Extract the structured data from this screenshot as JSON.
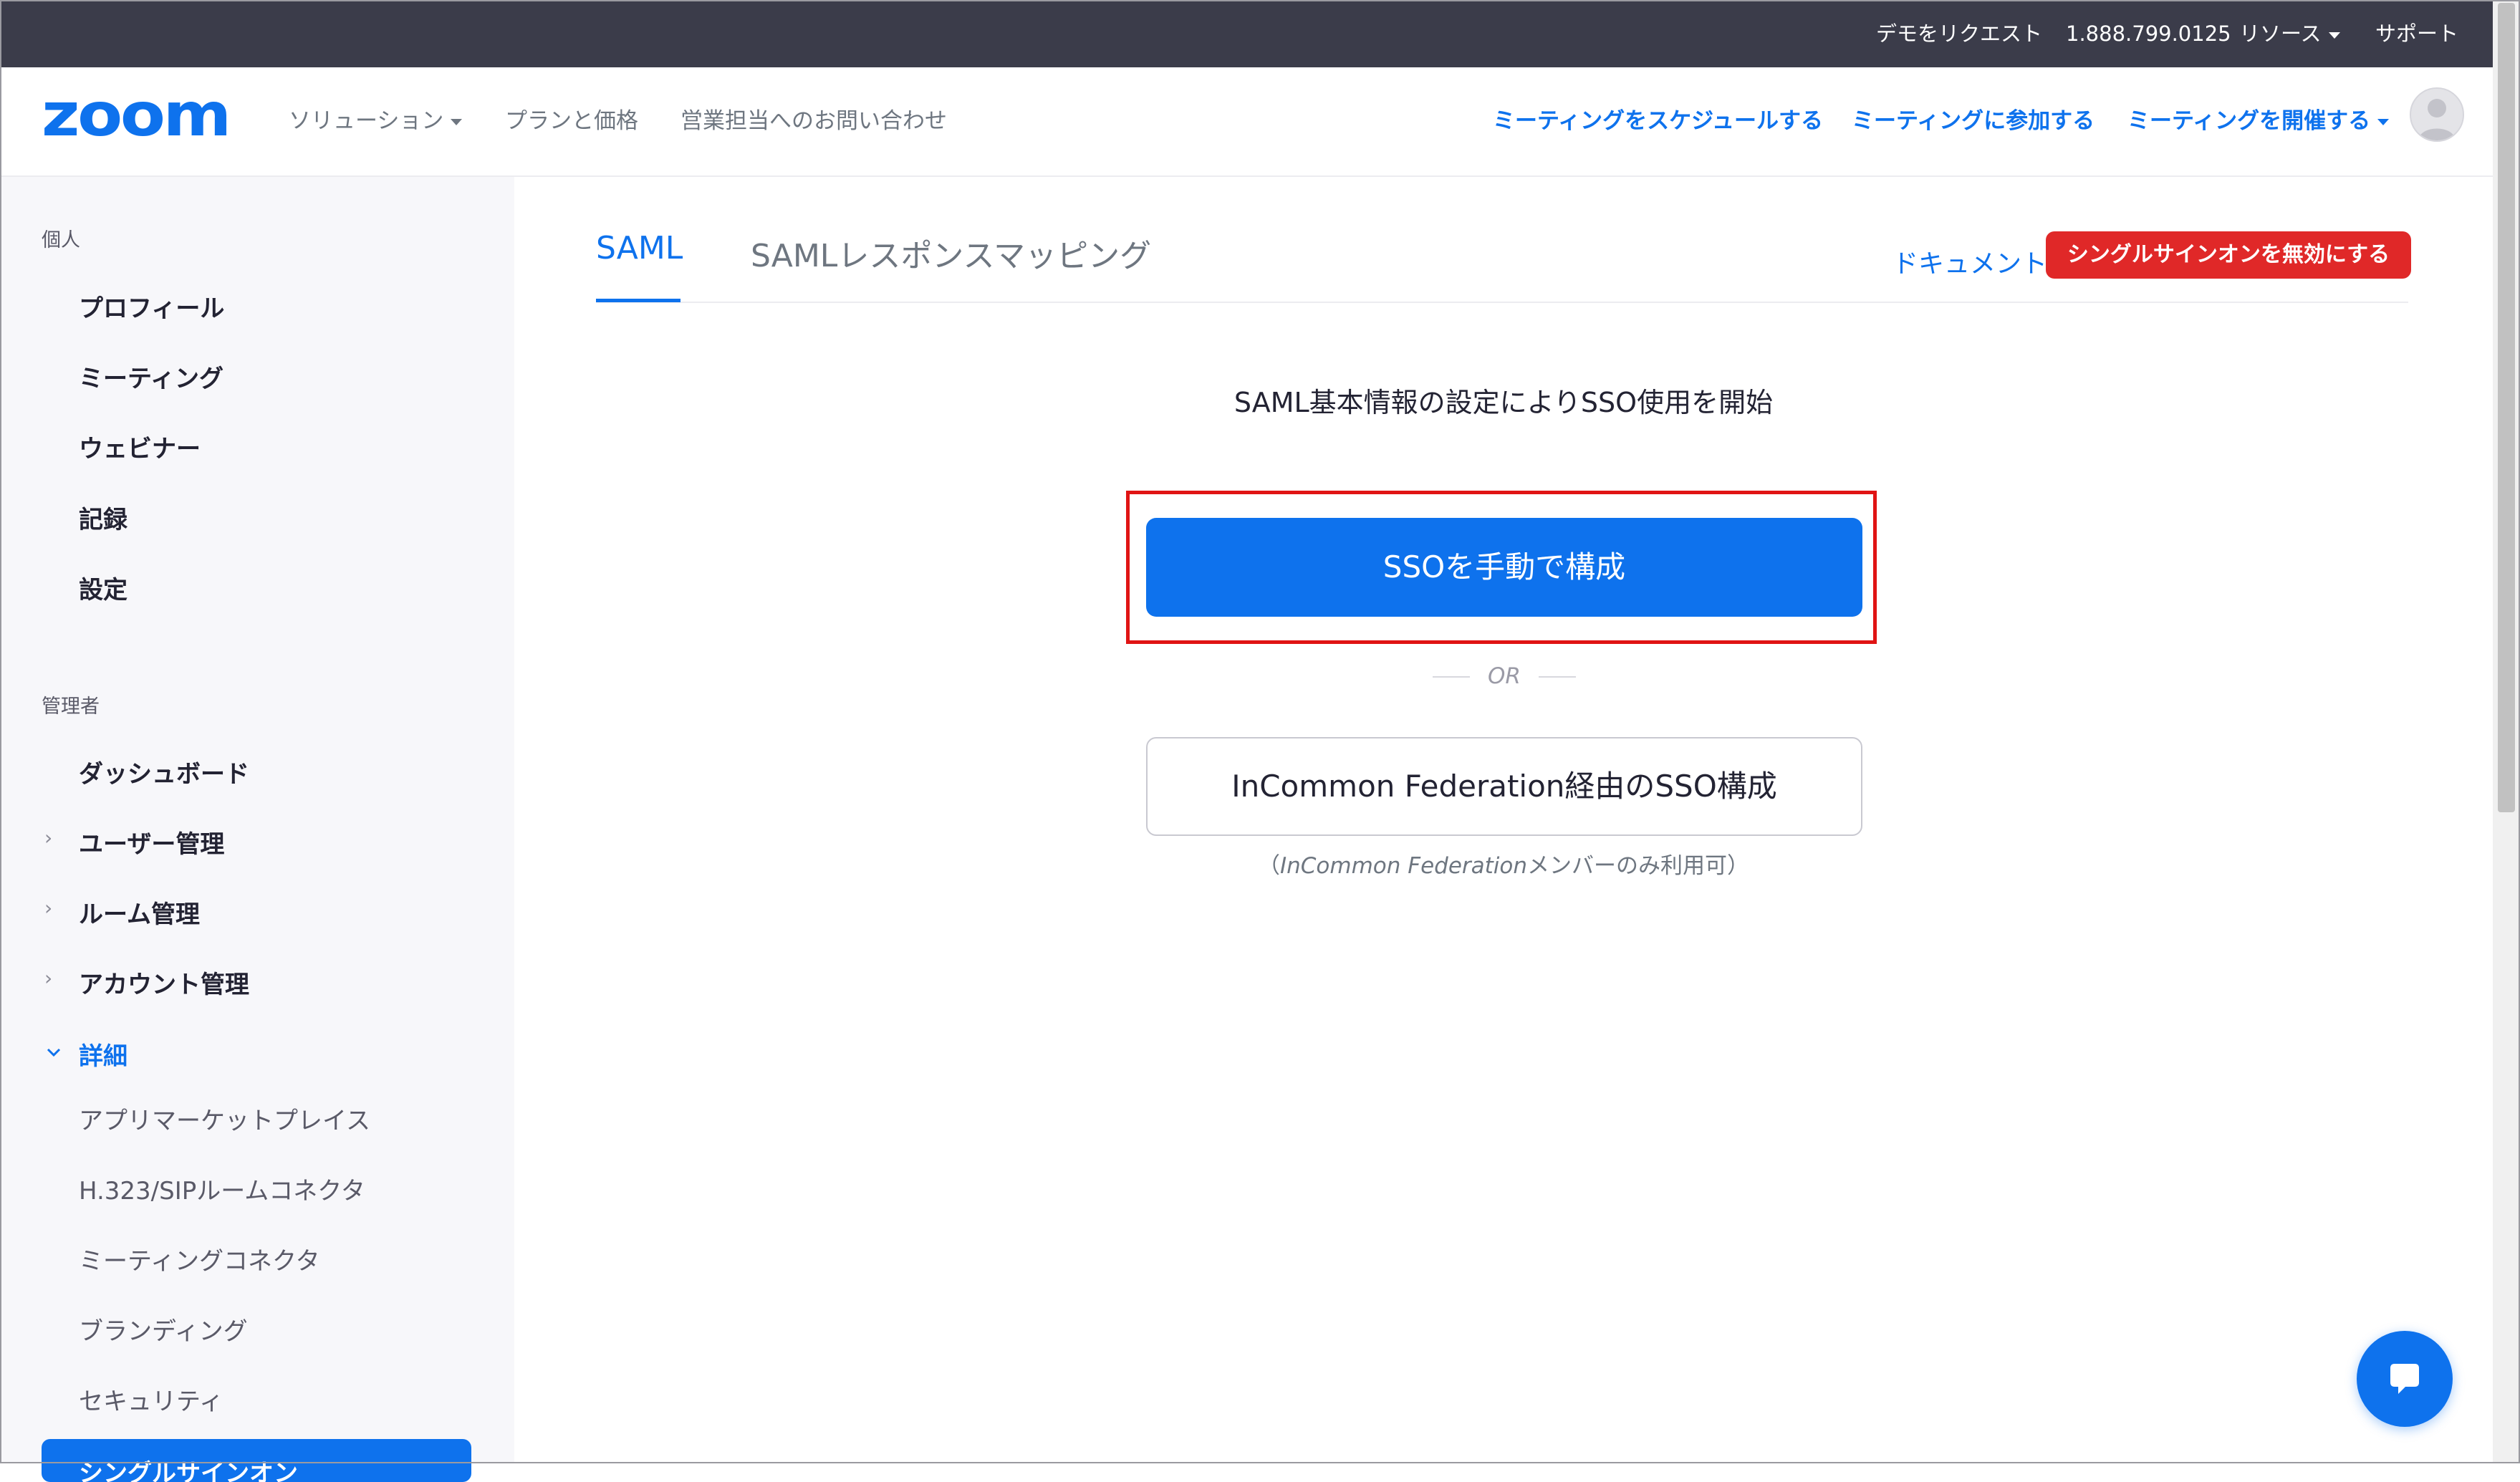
{
  "topbar": {
    "request_demo": "デモをリクエスト",
    "phone": "1.888.799.0125",
    "resources": "リソース",
    "support": "サポート"
  },
  "header": {
    "logo_text": "zoom",
    "nav": {
      "solutions": "ソリューション",
      "plans": "プランと価格",
      "contact_sales": "営業担当へのお問い合わせ",
      "schedule": "ミーティングをスケジュールする",
      "join": "ミーティングに参加する",
      "host": "ミーティングを開催する"
    }
  },
  "sidebar": {
    "personal_label": "個人",
    "personal_items": [
      "プロフィール",
      "ミーティング",
      "ウェビナー",
      "記録",
      "設定"
    ],
    "admin_label": "管理者",
    "dashboard": "ダッシュボード",
    "user_mgmt": "ユーザー管理",
    "room_mgmt": "ルーム管理",
    "account_mgmt": "アカウント管理",
    "advanced": "詳細",
    "advanced_items": [
      "アプリマーケットプレイス",
      "H.323/SIPルームコネクタ",
      "ミーティングコネクタ",
      "ブランディング",
      "セキュリティ"
    ],
    "active_item": "シングルサインオン"
  },
  "main": {
    "tabs": {
      "saml": "SAML",
      "mapping": "SAMLレスポンスマッピング"
    },
    "doc_link": "ドキュメント",
    "disable_sso": "シングルサインオンを無効にする",
    "intro": "SAML基本情報の設定によりSSO使用を開始",
    "manual_button": "SSOを手動で構成",
    "or_text": "OR",
    "incommon_button": "InCommon Federation経由のSSO構成",
    "incommon_note_open": "（",
    "incommon_note_em": "InCommon Federation",
    "incommon_note_rest": "メンバーのみ利用可）"
  },
  "colors": {
    "brand_blue": "#0e72ed",
    "danger_red": "#e02828",
    "topbar_bg": "#3b3c4a",
    "sidebar_bg": "#f7f7fa",
    "highlight_red": "#e01414"
  },
  "icons": {
    "dropdown": "caret-down-icon",
    "collapsed": "chevron-right-icon",
    "expanded": "chevron-down-icon",
    "avatar": "user-avatar-icon",
    "chat": "chat-bubble-icon"
  }
}
